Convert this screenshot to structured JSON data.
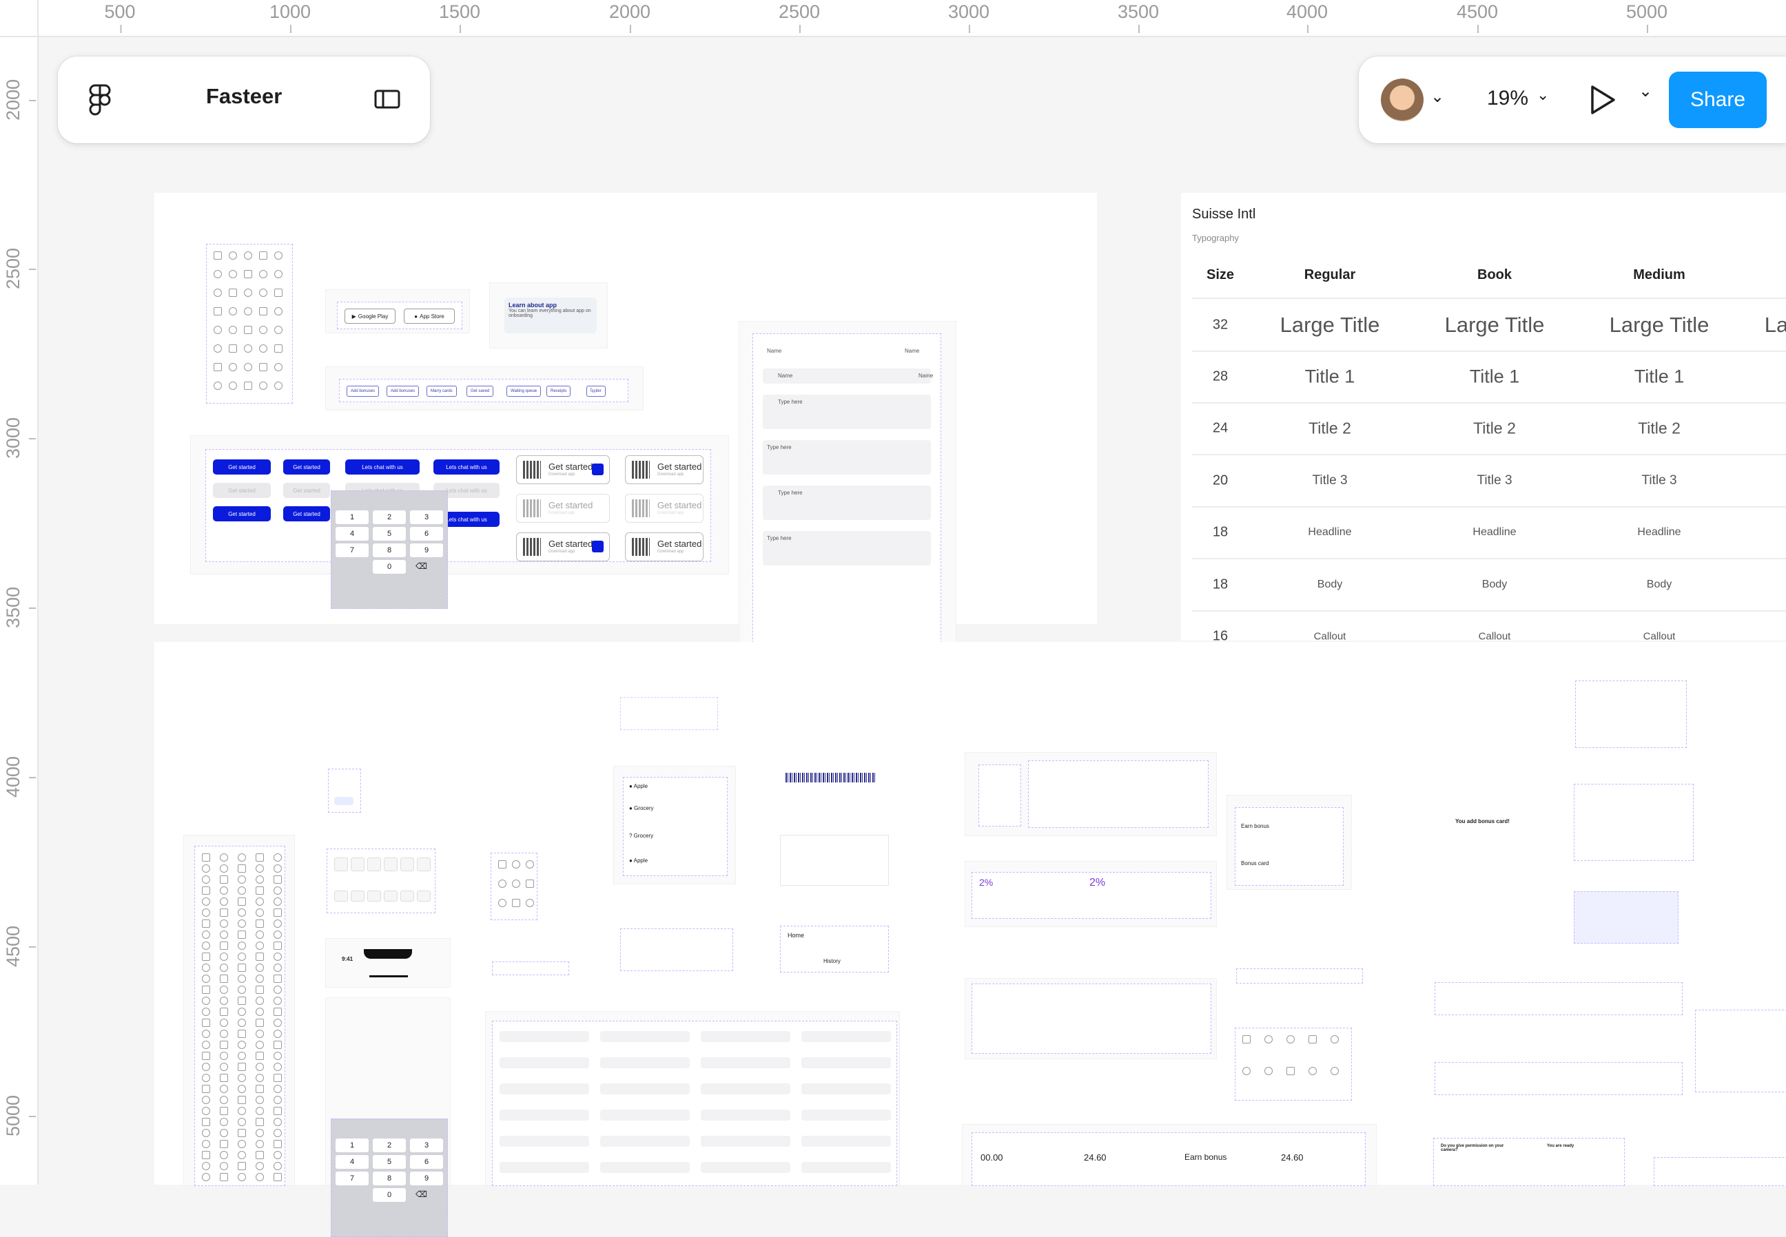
{
  "ruler": {
    "top": [
      "500",
      "1000",
      "1500",
      "2000",
      "2500",
      "3000",
      "3500",
      "4000",
      "4500",
      "5000"
    ],
    "left": [
      "2000",
      "2500",
      "3000",
      "3500",
      "4000",
      "4500",
      "5000"
    ]
  },
  "toolbar": {
    "file_name": "Fasteer",
    "zoom": "19%",
    "share_label": "Share"
  },
  "typography": {
    "title": "Suisse Intl",
    "subtitle": "Typography",
    "headers": [
      "Size",
      "Regular",
      "Book",
      "Medium"
    ],
    "rows": [
      {
        "size": "32",
        "label": "Large Title"
      },
      {
        "size": "28",
        "label": "Title 1"
      },
      {
        "size": "24",
        "label": "Title 2"
      },
      {
        "size": "20",
        "label": "Title 3"
      },
      {
        "size": "18",
        "label": "Headline"
      },
      {
        "size": "18",
        "label": "Body"
      },
      {
        "size": "16",
        "label": "Callout"
      }
    ],
    "overflow_prefix": "La"
  },
  "components": {
    "learn_title": "Learn about app",
    "learn_body": "You can learn everything about app on onboarding",
    "store_buttons": [
      "Google Play",
      "App Store"
    ],
    "chips": [
      "Add bonuses",
      "Add bonuses",
      "Marry cards",
      "Get saved",
      "Waiting queue",
      "Receipts",
      "Îşçiler"
    ],
    "get_started": "Get started",
    "lets_chat": "Lets chat with us",
    "download_app": "Download app",
    "form_labels": [
      "Name",
      "Name",
      "Name",
      "Name",
      "Type here",
      "Type here",
      "Type here",
      "Type here"
    ]
  },
  "lower": {
    "home": "Home",
    "history": "History",
    "earn_bonus": "Earn bonus",
    "bonus_card": "Bonus card",
    "percent": "2%",
    "you_add_bonus": "You add bonus card!",
    "apple": "Apple",
    "grocery": "Grocery",
    "keypad": [
      "1",
      "2",
      "3",
      "4",
      "5",
      "6",
      "7",
      "8",
      "9",
      "0"
    ],
    "time": "9:41",
    "values": [
      "00.00",
      "24.60",
      "24.60"
    ],
    "earn_bonus_bottom": "Earn bonus",
    "permission": "Do you give permission on your camera?",
    "ready": "You are ready"
  }
}
